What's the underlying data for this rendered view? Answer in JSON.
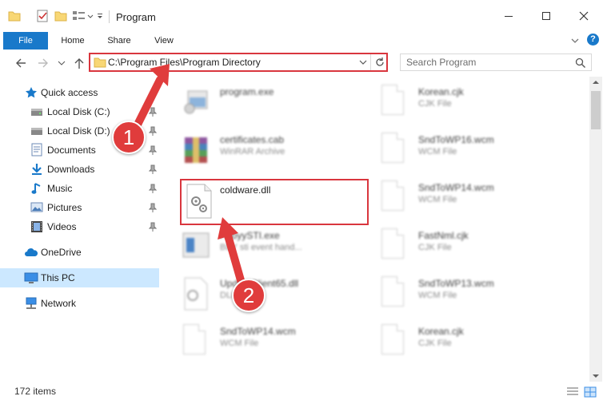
{
  "window": {
    "title": "Program",
    "minimize_icon": "minimize-icon",
    "maximize_icon": "maximize-icon",
    "close_icon": "close-icon"
  },
  "ribbon": {
    "tabs": [
      "File",
      "Home",
      "Share",
      "View"
    ],
    "help_icon": "help-icon"
  },
  "address": {
    "path": "C:\\Program Files\\Program Directory"
  },
  "search": {
    "placeholder": "Search Program"
  },
  "sidebar": {
    "items": [
      {
        "label": "Quick access",
        "icon": "star-icon",
        "pinned": false
      },
      {
        "label": "Local Disk (C:)",
        "icon": "drive-icon",
        "pinned": true
      },
      {
        "label": "Local Disk (D:)",
        "icon": "drive-icon",
        "pinned": true
      },
      {
        "label": "Documents",
        "icon": "documents-icon",
        "pinned": true
      },
      {
        "label": "Downloads",
        "icon": "download-icon",
        "pinned": true
      },
      {
        "label": "Music",
        "icon": "music-icon",
        "pinned": true
      },
      {
        "label": "Pictures",
        "icon": "pictures-icon",
        "pinned": true
      },
      {
        "label": "Videos",
        "icon": "videos-icon",
        "pinned": true
      },
      {
        "label": "OneDrive",
        "icon": "cloud-icon",
        "pinned": false
      },
      {
        "label": "This PC",
        "icon": "computer-icon",
        "pinned": false
      },
      {
        "label": "Network",
        "icon": "network-icon",
        "pinned": false
      }
    ]
  },
  "files": {
    "left": [
      {
        "name": "program.exe",
        "type": ""
      },
      {
        "name": "certificates.cab",
        "type": "WinRAR Archive"
      },
      {
        "name": "coldware.dll",
        "type": ""
      },
      {
        "name": "AbbyySTI.exe",
        "type": "BBY sti event hand..."
      },
      {
        "name": "UpdateClient65.dll",
        "type": "DLL"
      },
      {
        "name": "SndToWP14.wcm",
        "type": "WCM File"
      }
    ],
    "right": [
      {
        "name": "Korean.cjk",
        "type": "CJK File"
      },
      {
        "name": "SndToWP16.wcm",
        "type": "WCM File"
      },
      {
        "name": "SndToWP14.wcm",
        "type": "WCM File"
      },
      {
        "name": "FastNml.cjk",
        "type": "CJK File"
      },
      {
        "name": "SndToWP13.wcm",
        "type": "WCM File"
      },
      {
        "name": "Korean.cjk",
        "type": "CJK File"
      }
    ]
  },
  "annotations": {
    "step1": "1",
    "step2": "2"
  },
  "status": {
    "item_count": "172 items"
  },
  "colors": {
    "accent": "#1979ca",
    "highlight": "#d9363e",
    "selected_nav": "#cce8ff"
  }
}
